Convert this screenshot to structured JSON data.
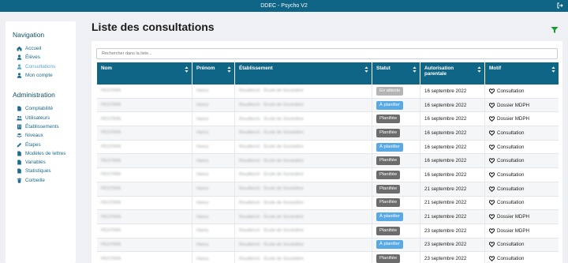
{
  "app": {
    "title": "DDEC - Psycho V2"
  },
  "sidebar": {
    "navigation_title": "Navigation",
    "nav_items": [
      {
        "label": "Accueil",
        "icon": "home-icon"
      },
      {
        "label": "Élèves",
        "icon": "user-icon"
      },
      {
        "label": "Consultations",
        "icon": "user-icon",
        "active": true
      },
      {
        "label": "Mon compte",
        "icon": "user-icon"
      }
    ],
    "admin_title": "Administration",
    "admin_items": [
      {
        "label": "Comptabilité",
        "icon": "document-icon"
      },
      {
        "label": "Utilisateurs",
        "icon": "users-icon"
      },
      {
        "label": "Établissements",
        "icon": "building-icon"
      },
      {
        "label": "Niveaux",
        "icon": "levels-icon"
      },
      {
        "label": "Étapes",
        "icon": "pencil-icon"
      },
      {
        "label": "Modèles de lettres",
        "icon": "document-icon"
      },
      {
        "label": "Variables",
        "icon": "document-icon"
      },
      {
        "label": "Statistiques",
        "icon": "document-icon"
      },
      {
        "label": "Corbeille",
        "icon": "trash-icon"
      }
    ]
  },
  "main": {
    "title": "Liste des consultations",
    "search_placeholder": "Rechercher dans la liste...",
    "columns": [
      "Nom",
      "Prénom",
      "Établissement",
      "Statut",
      "Autorisation parentale",
      "Motif"
    ],
    "rows": [
      {
        "nom": "PESTRIN",
        "prenom": "Hanry",
        "etab": "Roudlerch · École de Sociedère",
        "statut": "En attente",
        "statut_kind": "attente",
        "date": "16 septembre 2022",
        "motif": "Consultation"
      },
      {
        "nom": "PESTRIN",
        "prenom": "Hanry",
        "etab": "Roudlerch · École de Sociedère",
        "statut": "À planifier",
        "statut_kind": "planifier",
        "date": "16 septembre 2022",
        "motif": "Dossier MDPH"
      },
      {
        "nom": "PESTRIN",
        "prenom": "Hanry",
        "etab": "Roudlerch · École de Sociedère",
        "statut": "Planifiée",
        "statut_kind": "planifiee",
        "date": "16 septembre 2022",
        "motif": "Dossier MDPH"
      },
      {
        "nom": "PESTRIN",
        "prenom": "Hanry",
        "etab": "Roudlerch · École de Sociedère",
        "statut": "Planifiée",
        "statut_kind": "planifiee",
        "date": "16 septembre 2022",
        "motif": "Consultation"
      },
      {
        "nom": "PESTRIN",
        "prenom": "Hanry",
        "etab": "Roudlerch · École de Sociedère",
        "statut": "À planifier",
        "statut_kind": "planifier",
        "date": "16 septembre 2022",
        "motif": "Consultation"
      },
      {
        "nom": "PESTRIN",
        "prenom": "Hanry",
        "etab": "Roudlerch · École de Sociedère",
        "statut": "Planifiée",
        "statut_kind": "planifiee",
        "date": "16 septembre 2022",
        "motif": "Consultation"
      },
      {
        "nom": "PESTRIN",
        "prenom": "Hanry",
        "etab": "Roudlerch · École de Sociedère",
        "statut": "Planifiée",
        "statut_kind": "planifiee",
        "date": "16 septembre 2022",
        "motif": "Consultation"
      },
      {
        "nom": "PESTRIN",
        "prenom": "Hanry",
        "etab": "Roudlerch · École de Sociedère",
        "statut": "Planifiée",
        "statut_kind": "planifiee",
        "date": "21 septembre 2022",
        "motif": "Consultation"
      },
      {
        "nom": "PESTRIN",
        "prenom": "Hanry",
        "etab": "Roudlerch · École de Sociedère",
        "statut": "Planifiée",
        "statut_kind": "planifiee",
        "date": "21 septembre 2022",
        "motif": "Consultation"
      },
      {
        "nom": "PESTRIN",
        "prenom": "Hanry",
        "etab": "Roudlerch · École de Sociedère",
        "statut": "À planifier",
        "statut_kind": "planifier",
        "date": "21 septembre 2022",
        "motif": "Dossier MDPH"
      },
      {
        "nom": "PESTRIN",
        "prenom": "Hanry",
        "etab": "Roudlerch · École de Sociedère",
        "statut": "Planifiée",
        "statut_kind": "planifiee",
        "date": "23 septembre 2022",
        "motif": "Dossier MDPH"
      },
      {
        "nom": "PESTRIN",
        "prenom": "Hanry",
        "etab": "Roudlerch · École de Sociedère",
        "statut": "À planifier",
        "statut_kind": "planifier",
        "date": "23 septembre 2022",
        "motif": "Consultation"
      },
      {
        "nom": "PESTRIN",
        "prenom": "Hanry",
        "etab": "Roudlerch · École de Sociedère",
        "statut": "Planifiée",
        "statut_kind": "planifiee",
        "date": "23 septembre 2022",
        "motif": "Consultation"
      }
    ]
  },
  "colors": {
    "brand": "#0f6585",
    "accent": "#1a9a2e"
  }
}
